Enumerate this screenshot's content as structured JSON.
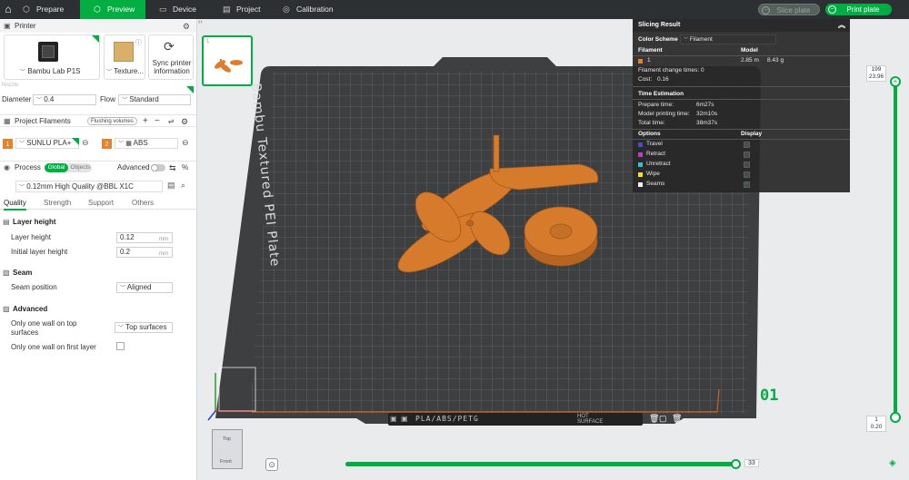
{
  "topbar": {
    "tabs": [
      {
        "label": "Prepare",
        "icon": "cube-icon"
      },
      {
        "label": "Preview",
        "icon": "preview-cube-icon"
      },
      {
        "label": "Device",
        "icon": "monitor-icon"
      },
      {
        "label": "Project",
        "icon": "folder-icon"
      },
      {
        "label": "Calibration",
        "icon": "calibration-icon"
      }
    ],
    "active_tab": "Preview",
    "slice_label": "Slice plate",
    "print_label": "Print plate"
  },
  "printer": {
    "section": "Printer",
    "name": "Bambu Lab P1S",
    "plate": "Texture...",
    "sync_label_1": "Sync printer",
    "sync_label_2": "information",
    "nozzle_label": "Nozzle",
    "diameter_label": "Diameter",
    "diameter_value": "0.4",
    "flow_label": "Flow",
    "flow_value": "Standard"
  },
  "filaments": {
    "section": "Project Filaments",
    "flushing_label": "Flushing volumes",
    "items": [
      {
        "index": "1",
        "name": "SUNLU PLA+",
        "color": "#e8822a"
      },
      {
        "index": "2",
        "name": "ABS",
        "color": "#e8822a"
      }
    ]
  },
  "process": {
    "section": "Process",
    "toggle_global": "Global",
    "toggle_objects": "Objects",
    "advanced_label": "Advanced",
    "preset": "0.12mm High Quality @BBL X1C",
    "tabs": [
      "Quality",
      "Strength",
      "Support",
      "Others"
    ],
    "layer_height_group": "Layer height",
    "layer_height_label": "Layer height",
    "layer_height_value": "0.12",
    "initial_layer_height_label": "Initial layer height",
    "initial_layer_height_value": "0.2",
    "unit": "mm",
    "seam_group": "Seam",
    "seam_position_label": "Seam position",
    "seam_position_value": "Aligned",
    "advanced_group": "Advanced",
    "one_wall_top_label_1": "Only one wall on top",
    "one_wall_top_label_2": "surfaces",
    "one_wall_top_value": "Top surfaces",
    "one_wall_first_label": "Only one wall on first layer",
    "one_wall_first_checked": false
  },
  "viewport": {
    "plate_index": "1",
    "bed_label": "Bambu Textured PEI Plate",
    "plate_number": "01",
    "bed_strip_text": "PLA/ABS/PETG",
    "hot_label_1": "HOT",
    "hot_label_2": "SURFACE",
    "view_cube_top": "Top",
    "view_cube_front": "Front",
    "accent_color": "#00ae42",
    "part_color": "#d67a2c"
  },
  "slicing_result": {
    "title": "Slicing Result",
    "color_scheme_label": "Color Scheme",
    "color_scheme_value": "Filament",
    "filament_col": "Filament",
    "model_col": "Model",
    "filament_index": "1",
    "filament_length": "2.85 m",
    "filament_weight": "8.43 g",
    "change_times_label": "Filament change times:",
    "change_times_value": "0",
    "cost_label": "Cost:",
    "cost_value": "0.16",
    "time_estimation": "Time Estimation",
    "prepare_time_label": "Prepare time:",
    "prepare_time_value": "6m27s",
    "model_time_label": "Model printing time:",
    "model_time_value": "32m10s",
    "total_time_label": "Total time:",
    "total_time_value": "38m37s",
    "options_col": "Options",
    "display_col": "Display",
    "options": [
      {
        "label": "Travel",
        "color": "#4a4ad0",
        "checked": false
      },
      {
        "label": "Retract",
        "color": "#c23bc2",
        "checked": false
      },
      {
        "label": "Unretract",
        "color": "#36c0c6",
        "checked": false
      },
      {
        "label": "Wipe",
        "color": "#f0e020",
        "checked": false
      },
      {
        "label": "Seams",
        "color": "#f2f2f2",
        "checked": true
      }
    ]
  },
  "layer_slider": {
    "top_layer": "199",
    "top_height": "23.96",
    "bottom_layer": "1",
    "bottom_height": "0.20"
  },
  "move_slider": {
    "value": "33"
  }
}
